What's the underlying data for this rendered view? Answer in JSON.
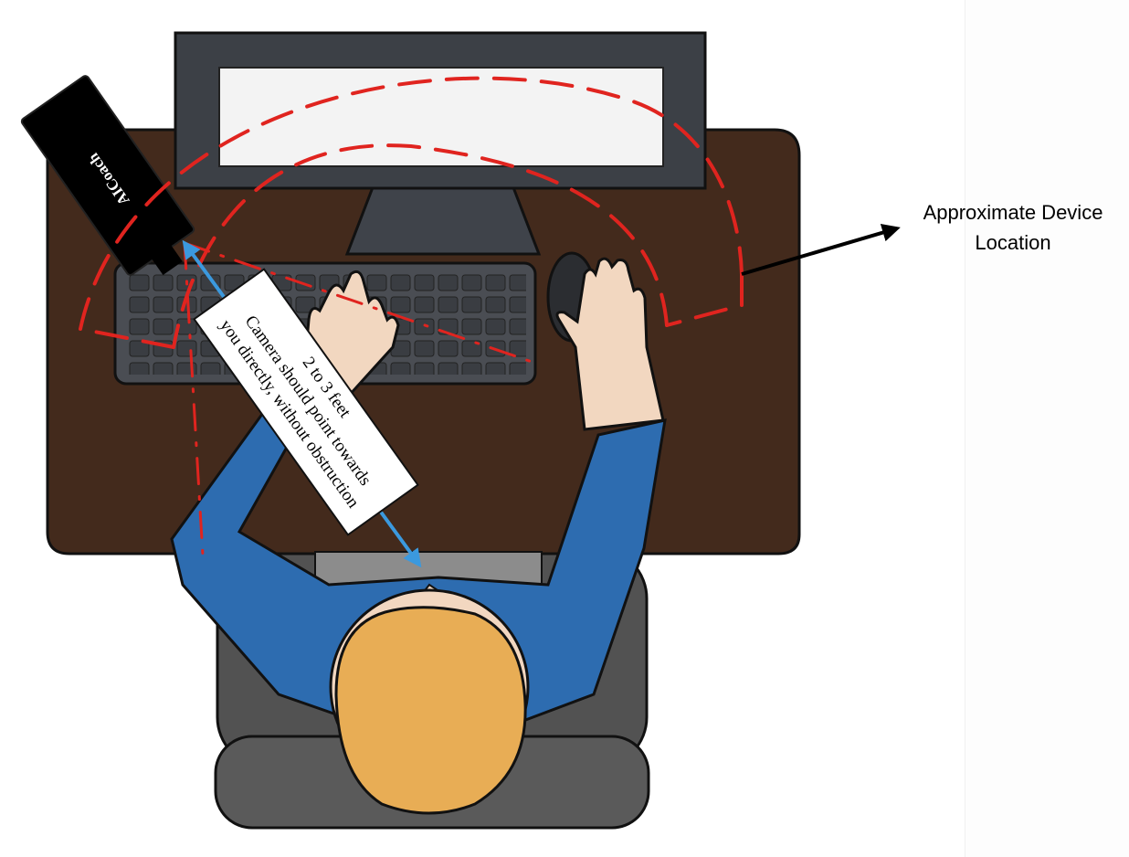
{
  "device": {
    "brand_label": "AICoach"
  },
  "callout": {
    "distance": "2 to 3 feet",
    "line1": "Camera should point towards",
    "line2": "you directly, without obstruction"
  },
  "location_label": {
    "line1": "Approximate Device",
    "line2": "Location"
  },
  "colors": {
    "desk": "#432a1c",
    "monitor_frame": "#3c4046",
    "screen": "#f3f3f3",
    "keyboard": "#4a4d53",
    "shirt": "#2d6cb0",
    "hair": "#e8ad55",
    "skin": "#f2d7c0",
    "chair": "#525252",
    "zone_dash": "#e0241f",
    "arrow_blue": "#3b99de",
    "arrow_black": "#000000"
  },
  "icons": [
    "phone-device",
    "computer-monitor",
    "keyboard",
    "mouse",
    "person-top-view",
    "office-chair"
  ]
}
